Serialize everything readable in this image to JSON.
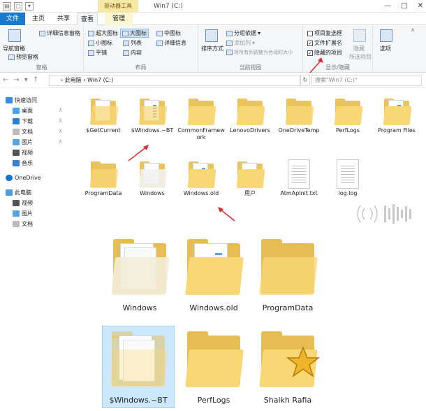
{
  "titlebar": {
    "context_tab": "驱动器工具",
    "title": "Win7 (C:)",
    "minimize": "—",
    "maximize": "□",
    "close": "✕"
  },
  "tabs": {
    "file": "文件",
    "home": "主页",
    "share": "共享",
    "view": "查看",
    "manage": "管理"
  },
  "ribbon": {
    "panes": {
      "nav_pane": "导航窗格",
      "preview_pane": "预览窗格",
      "details_pane": "详细信息窗格",
      "label": "窗格"
    },
    "layout": {
      "extra_large": "超大图标",
      "large": "大图标",
      "medium": "中图标",
      "small": "小图标",
      "list": "列表",
      "details": "详细信息",
      "tiles": "平铺",
      "content": "内容",
      "label": "布局"
    },
    "current_view": {
      "sort_by": "排序方式",
      "group_by": "分组依据",
      "add_columns": "添加列",
      "size_all": "将所有列调整为合适的大小",
      "label": "当前视图"
    },
    "show_hide": {
      "item_checkboxes": "项目复选框",
      "file_extensions": "文件扩展名",
      "hidden_items": "隐藏的项目",
      "hide": "隐藏",
      "selected_items": "所选项目",
      "label": "显示/隐藏"
    },
    "options": "选项"
  },
  "address": {
    "back": "←",
    "forward": "→",
    "up": "↑",
    "crumb": "› 此电脑 › Win7 (C:)",
    "refresh": "↻",
    "search_placeholder": "搜索\"Win7 (C:)\""
  },
  "sidebar": {
    "items": [
      {
        "label": "快速访问"
      },
      {
        "label": "桌面"
      },
      {
        "label": "下载"
      },
      {
        "label": "文档"
      },
      {
        "label": "图片"
      },
      {
        "label": "视频"
      },
      {
        "label": "音乐"
      },
      {
        "label": "OneDrive"
      },
      {
        "label": "此电脑"
      },
      {
        "label": "视频"
      },
      {
        "label": "图片"
      },
      {
        "label": "文档"
      }
    ]
  },
  "files": [
    {
      "label": "$GetCurrent"
    },
    {
      "label": "$Windows.~BT"
    },
    {
      "label": "CommonFramework"
    },
    {
      "label": "LenovoDrivers"
    },
    {
      "label": "OneDriveTemp"
    },
    {
      "label": "PerfLogs"
    },
    {
      "label": "Program Files"
    },
    {
      "label": "ProgramData"
    },
    {
      "label": "Windows"
    },
    {
      "label": "Windows.old"
    },
    {
      "label": "用户"
    },
    {
      "label": "AtmApInit.txt"
    },
    {
      "label": "log.log"
    }
  ],
  "zoom": [
    {
      "label": "Windows"
    },
    {
      "label": "Windows.old"
    },
    {
      "label": "ProgramData"
    },
    {
      "label": "$Windows.~BT"
    },
    {
      "label": "PerfLogs"
    },
    {
      "label": "Shaikh Rafia"
    }
  ],
  "colors": {
    "file_tab": "#1979ca",
    "folder": "#f8d775",
    "annotation_arrow": "#d32f2f",
    "selection": "#cce8ff"
  }
}
